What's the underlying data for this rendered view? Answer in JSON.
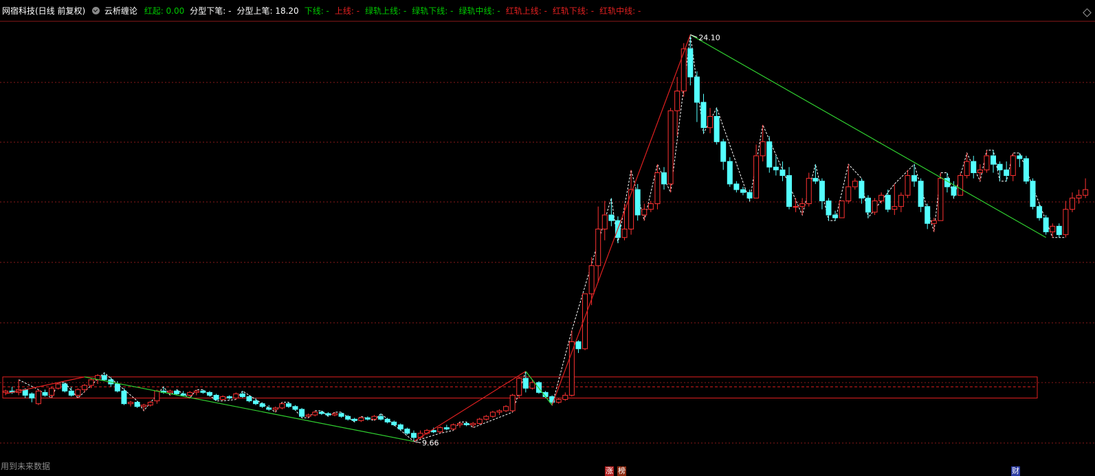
{
  "header": {
    "stock_title": "网宿科技(日线 前复权)",
    "indicator_name": "云析缠论",
    "items": [
      {
        "label": "红起: ",
        "value": "0.00",
        "color": "#00c800"
      },
      {
        "label": "分型下笔: ",
        "value": "-",
        "color": "#ffffff"
      },
      {
        "label": "分型上笔: ",
        "value": "18.20",
        "color": "#ffffff"
      },
      {
        "label": "下线: ",
        "value": "-",
        "color": "#00c800"
      },
      {
        "label": "上线: ",
        "value": "-",
        "color": "#e02020"
      },
      {
        "label": "绿轨上线: ",
        "value": "-",
        "color": "#00c800"
      },
      {
        "label": "绿轨下线: ",
        "value": "-",
        "color": "#00c800"
      },
      {
        "label": "绿轨中线: ",
        "value": "-",
        "color": "#00c800"
      },
      {
        "label": "红轨上线: ",
        "value": "-",
        "color": "#e02020"
      },
      {
        "label": "红轨下线: ",
        "value": "-",
        "color": "#e02020"
      },
      {
        "label": "红轨中线: ",
        "value": "-",
        "color": "#e02020"
      }
    ]
  },
  "footer": {
    "future_data_note": "用到未来数据",
    "tags": [
      {
        "text": "涨",
        "color": "#b02020"
      },
      {
        "text": "榜",
        "color": "#8a2a10"
      },
      {
        "text": "财",
        "color": "#2a3aa0"
      }
    ]
  },
  "colors": {
    "up": "#ff3232",
    "down": "#54ffff",
    "stroke_up": "#e02020",
    "stroke_down": "#30d030",
    "box": "#e02020",
    "grid": "#8a1a1a",
    "fractal": "#ffffff"
  },
  "chart_data": {
    "type": "candlestick",
    "ylim": [
      8.75,
      24.6
    ],
    "high_label": "24.10",
    "low_label": "9.66",
    "candles": [
      [
        11.4,
        11.5,
        11.3,
        11.45
      ],
      [
        11.45,
        11.6,
        11.35,
        11.4
      ],
      [
        11.4,
        11.85,
        11.3,
        11.5
      ],
      [
        11.5,
        11.55,
        11.2,
        11.3
      ],
      [
        11.35,
        11.4,
        11.05,
        11.2
      ],
      [
        11.0,
        11.5,
        10.95,
        11.45
      ],
      [
        11.4,
        11.5,
        11.25,
        11.3
      ],
      [
        11.3,
        11.6,
        11.2,
        11.55
      ],
      [
        11.55,
        11.75,
        11.5,
        11.7
      ],
      [
        11.7,
        11.75,
        11.4,
        11.45
      ],
      [
        11.45,
        11.6,
        11.25,
        11.3
      ],
      [
        11.3,
        11.55,
        11.2,
        11.5
      ],
      [
        11.5,
        11.7,
        11.4,
        11.65
      ],
      [
        11.65,
        11.9,
        11.55,
        11.85
      ],
      [
        11.85,
        12.05,
        11.7,
        12.0
      ],
      [
        12.0,
        12.1,
        11.8,
        11.85
      ],
      [
        11.85,
        11.95,
        11.6,
        11.7
      ],
      [
        11.7,
        11.8,
        11.4,
        11.45
      ],
      [
        11.45,
        11.55,
        10.95,
        11.0
      ],
      [
        11.0,
        11.1,
        10.9,
        11.05
      ],
      [
        11.05,
        11.1,
        10.85,
        10.9
      ],
      [
        10.9,
        11.0,
        10.75,
        10.95
      ],
      [
        10.95,
        11.1,
        10.9,
        11.05
      ],
      [
        11.1,
        11.5,
        11.0,
        11.45
      ],
      [
        11.45,
        11.6,
        11.35,
        11.4
      ],
      [
        11.4,
        11.5,
        11.3,
        11.45
      ],
      [
        11.45,
        11.5,
        11.3,
        11.35
      ],
      [
        11.35,
        11.45,
        11.25,
        11.3
      ],
      [
        11.3,
        11.45,
        11.2,
        11.4
      ],
      [
        11.4,
        11.5,
        11.3,
        11.45
      ],
      [
        11.45,
        11.5,
        11.35,
        11.4
      ],
      [
        11.4,
        11.45,
        11.25,
        11.3
      ],
      [
        11.3,
        11.35,
        11.1,
        11.15
      ],
      [
        11.15,
        11.3,
        11.1,
        11.25
      ],
      [
        11.25,
        11.3,
        11.15,
        11.2
      ],
      [
        11.2,
        11.4,
        11.15,
        11.35
      ],
      [
        11.35,
        11.45,
        11.2,
        11.25
      ],
      [
        11.25,
        11.3,
        11.05,
        11.1
      ],
      [
        11.1,
        11.2,
        10.95,
        11.0
      ],
      [
        11.0,
        11.05,
        10.85,
        10.9
      ],
      [
        10.85,
        10.95,
        10.75,
        10.8
      ],
      [
        10.8,
        10.9,
        10.7,
        10.85
      ],
      [
        10.85,
        11.05,
        10.8,
        11.0
      ],
      [
        11.0,
        11.05,
        10.85,
        10.9
      ],
      [
        10.9,
        10.95,
        10.75,
        10.8
      ],
      [
        10.8,
        10.85,
        10.5,
        10.55
      ],
      [
        10.55,
        10.65,
        10.5,
        10.6
      ],
      [
        10.6,
        10.75,
        10.55,
        10.7
      ],
      [
        10.7,
        10.75,
        10.6,
        10.65
      ],
      [
        10.65,
        10.7,
        10.55,
        10.6
      ],
      [
        10.6,
        10.7,
        10.55,
        10.65
      ],
      [
        10.65,
        10.7,
        10.5,
        10.55
      ],
      [
        10.55,
        10.6,
        10.4,
        10.45
      ],
      [
        10.45,
        10.5,
        10.35,
        10.4
      ],
      [
        10.4,
        10.55,
        10.35,
        10.5
      ],
      [
        10.5,
        10.55,
        10.4,
        10.45
      ],
      [
        10.45,
        10.6,
        10.4,
        10.55
      ],
      [
        10.55,
        10.65,
        10.4,
        10.45
      ],
      [
        10.45,
        10.5,
        10.3,
        10.35
      ],
      [
        10.35,
        10.4,
        10.2,
        10.25
      ],
      [
        10.25,
        10.3,
        10.05,
        10.1
      ],
      [
        10.1,
        10.15,
        9.9,
        9.95
      ],
      [
        9.95,
        10.05,
        9.66,
        9.8
      ],
      [
        9.8,
        10.05,
        9.75,
        9.95
      ],
      [
        9.95,
        10.1,
        9.9,
        10.05
      ],
      [
        10.05,
        10.15,
        9.95,
        10.0
      ],
      [
        10.0,
        10.2,
        9.95,
        10.15
      ],
      [
        10.15,
        10.25,
        10.05,
        10.1
      ],
      [
        10.1,
        10.3,
        10.05,
        10.25
      ],
      [
        10.25,
        10.35,
        10.15,
        10.3
      ],
      [
        10.3,
        10.35,
        10.2,
        10.25
      ],
      [
        10.25,
        10.35,
        10.15,
        10.3
      ],
      [
        10.3,
        10.5,
        10.25,
        10.45
      ],
      [
        10.45,
        10.6,
        10.4,
        10.55
      ],
      [
        10.55,
        10.75,
        10.5,
        10.7
      ],
      [
        10.7,
        10.8,
        10.6,
        10.75
      ],
      [
        10.75,
        10.95,
        10.7,
        10.9
      ],
      [
        10.75,
        11.35,
        10.7,
        11.3
      ],
      [
        11.3,
        11.95,
        11.2,
        11.9
      ],
      [
        11.9,
        12.15,
        11.4,
        11.55
      ],
      [
        11.55,
        11.85,
        11.5,
        11.75
      ],
      [
        11.75,
        11.8,
        11.35,
        11.4
      ],
      [
        11.4,
        11.45,
        11.2,
        11.25
      ],
      [
        11.25,
        11.3,
        10.95,
        11.05
      ],
      [
        11.05,
        11.2,
        11.0,
        11.15
      ],
      [
        11.15,
        11.4,
        11.1,
        11.3
      ],
      [
        11.3,
        13.6,
        11.25,
        13.2
      ],
      [
        13.2,
        13.25,
        12.8,
        12.95
      ],
      [
        12.95,
        14.9,
        12.9,
        14.9
      ],
      [
        14.9,
        16.2,
        14.5,
        15.9
      ],
      [
        15.9,
        18.0,
        15.3,
        17.2
      ],
      [
        17.2,
        18.2,
        16.8,
        17.7
      ],
      [
        17.7,
        18.3,
        17.3,
        17.5
      ],
      [
        17.5,
        17.65,
        16.7,
        16.9
      ],
      [
        16.9,
        18.1,
        16.8,
        17.2
      ],
      [
        17.2,
        19.3,
        17.0,
        18.6
      ],
      [
        18.6,
        18.8,
        17.5,
        17.7
      ],
      [
        17.7,
        18.1,
        17.5,
        17.9
      ],
      [
        17.9,
        18.2,
        17.8,
        18.1
      ],
      [
        18.1,
        19.5,
        17.9,
        19.2
      ],
      [
        19.2,
        19.4,
        18.6,
        18.8
      ],
      [
        18.8,
        21.5,
        18.5,
        21.4
      ],
      [
        21.4,
        22.6,
        20.5,
        22.1
      ],
      [
        22.1,
        23.8,
        21.9,
        23.6
      ],
      [
        23.6,
        24.1,
        22.3,
        22.6
      ],
      [
        22.6,
        22.8,
        21.0,
        21.7
      ],
      [
        21.7,
        22.0,
        20.6,
        20.8
      ],
      [
        20.8,
        21.5,
        20.6,
        21.2
      ],
      [
        21.2,
        21.5,
        20.2,
        20.3
      ],
      [
        20.3,
        20.4,
        19.3,
        19.6
      ],
      [
        19.6,
        19.75,
        18.7,
        18.8
      ],
      [
        18.8,
        18.9,
        18.5,
        18.6
      ],
      [
        18.6,
        18.7,
        18.4,
        18.5
      ],
      [
        18.5,
        18.6,
        18.2,
        18.3
      ],
      [
        18.3,
        20.2,
        18.3,
        19.8
      ],
      [
        19.8,
        20.9,
        19.6,
        20.3
      ],
      [
        20.3,
        20.5,
        19.2,
        19.4
      ],
      [
        19.4,
        19.8,
        19.1,
        19.3
      ],
      [
        19.3,
        19.6,
        18.9,
        19.1
      ],
      [
        19.1,
        19.4,
        17.9,
        18.0
      ],
      [
        18.0,
        18.3,
        17.8,
        18.0
      ],
      [
        18.0,
        18.3,
        17.7,
        18.1
      ],
      [
        18.1,
        19.2,
        18.0,
        19.0
      ],
      [
        19.0,
        19.5,
        18.8,
        18.9
      ],
      [
        18.9,
        19.0,
        17.9,
        18.2
      ],
      [
        18.2,
        18.3,
        17.5,
        17.7
      ],
      [
        17.7,
        17.85,
        17.5,
        17.6
      ],
      [
        17.6,
        18.2,
        17.6,
        18.2
      ],
      [
        18.2,
        19.5,
        18.1,
        18.7
      ],
      [
        18.7,
        19.0,
        18.6,
        18.9
      ],
      [
        18.9,
        19.0,
        18.1,
        18.3
      ],
      [
        18.3,
        18.4,
        17.6,
        17.8
      ],
      [
        17.8,
        18.3,
        17.7,
        18.2
      ],
      [
        18.2,
        18.5,
        18.1,
        18.4
      ],
      [
        18.4,
        18.6,
        17.8,
        17.9
      ],
      [
        17.9,
        18.8,
        17.7,
        18.0
      ],
      [
        18.0,
        18.5,
        17.8,
        18.4
      ],
      [
        18.4,
        19.3,
        18.3,
        19.1
      ],
      [
        19.1,
        19.5,
        18.7,
        18.9
      ],
      [
        18.9,
        19.0,
        17.8,
        18.0
      ],
      [
        18.0,
        18.1,
        17.2,
        17.4
      ],
      [
        17.4,
        17.6,
        17.1,
        17.5
      ],
      [
        17.5,
        19.2,
        17.5,
        19.0
      ],
      [
        19.0,
        19.2,
        18.5,
        18.7
      ],
      [
        18.7,
        18.9,
        18.3,
        18.4
      ],
      [
        18.4,
        19.2,
        18.4,
        19.1
      ],
      [
        19.1,
        19.9,
        19.0,
        19.6
      ],
      [
        19.6,
        19.8,
        19.0,
        19.2
      ],
      [
        19.2,
        19.5,
        18.9,
        19.3
      ],
      [
        19.3,
        20.0,
        19.2,
        19.8
      ],
      [
        19.8,
        20.0,
        19.2,
        19.5
      ],
      [
        19.5,
        19.6,
        18.9,
        19.3
      ],
      [
        19.3,
        19.6,
        18.9,
        19.1
      ],
      [
        19.1,
        19.9,
        18.9,
        19.8
      ],
      [
        19.8,
        19.9,
        19.4,
        19.7
      ],
      [
        19.7,
        19.8,
        18.8,
        18.9
      ],
      [
        18.9,
        19.0,
        17.9,
        18.0
      ],
      [
        18.0,
        18.1,
        17.5,
        17.6
      ],
      [
        17.6,
        17.7,
        17.0,
        17.1
      ],
      [
        17.1,
        17.4,
        16.9,
        17.3
      ],
      [
        17.3,
        17.4,
        16.9,
        17.0
      ],
      [
        17.0,
        18.2,
        16.9,
        17.9
      ],
      [
        17.9,
        18.5,
        17.8,
        18.3
      ],
      [
        18.3,
        18.6,
        18.1,
        18.4
      ],
      [
        18.4,
        19.0,
        18.3,
        18.6
      ]
    ],
    "box": {
      "top": 11.95,
      "bottom": 11.2,
      "mid": 11.6
    },
    "strokes": [
      {
        "from": [
          0,
          11.35
        ],
        "to": [
          12,
          11.95
        ],
        "color": "up"
      },
      {
        "from": [
          12,
          11.95
        ],
        "to": [
          62,
          9.66
        ],
        "color": "down"
      },
      {
        "from": [
          62,
          9.66
        ],
        "to": [
          79,
          12.15
        ],
        "color": "up"
      },
      {
        "from": [
          79,
          12.15
        ],
        "to": [
          83,
          10.95
        ],
        "color": "down"
      },
      {
        "from": [
          83,
          10.95
        ],
        "to": [
          104,
          24.1
        ],
        "color": "up"
      },
      {
        "from": [
          104,
          24.1
        ],
        "to": [
          158,
          16.9
        ],
        "color": "down"
      }
    ]
  }
}
